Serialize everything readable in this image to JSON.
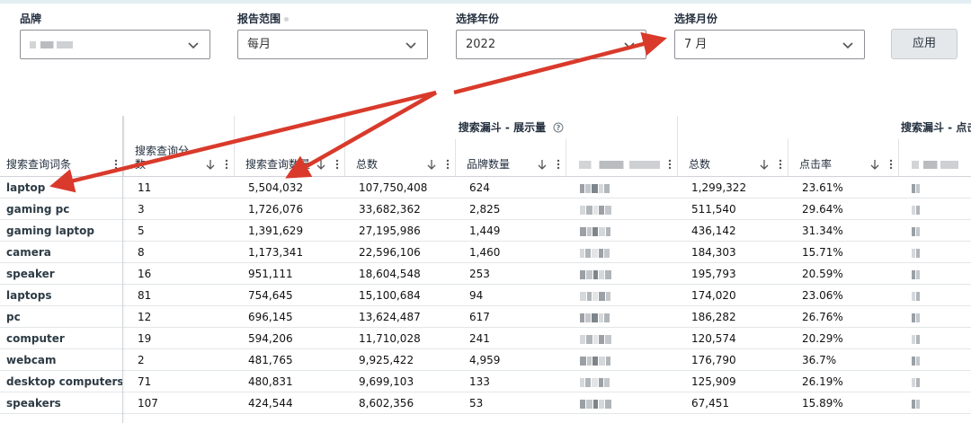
{
  "filters": {
    "brand": {
      "label": "品牌",
      "value": ""
    },
    "report_range": {
      "label": "报告范围",
      "value": "每月"
    },
    "year": {
      "label": "选择年份",
      "value": "2022"
    },
    "month": {
      "label": "选择月份",
      "value": "7 月"
    },
    "apply_label": "应用"
  },
  "table": {
    "groups": {
      "impressions": "搜索漏斗 - 展示量",
      "clicks": "搜索漏斗 - 点击"
    },
    "headers": {
      "keyword": "搜索查询词条",
      "score": "搜索查询分数",
      "volume": "搜索查询数量",
      "imp_total": "总数",
      "brand_count": "品牌数量",
      "click_total": "总数",
      "ctr": "点击率"
    },
    "rows": [
      {
        "keyword": "laptop",
        "score": "11",
        "volume": "5,504,032",
        "imp_total": "107,750,408",
        "brand_count": "624",
        "click_total": "1,299,322",
        "ctr": "23.61%"
      },
      {
        "keyword": "gaming pc",
        "score": "3",
        "volume": "1,726,076",
        "imp_total": "33,682,362",
        "brand_count": "2,825",
        "click_total": "511,540",
        "ctr": "29.64%"
      },
      {
        "keyword": "gaming laptop",
        "score": "5",
        "volume": "1,391,629",
        "imp_total": "27,195,986",
        "brand_count": "1,449",
        "click_total": "436,142",
        "ctr": "31.34%"
      },
      {
        "keyword": "camera",
        "score": "8",
        "volume": "1,173,341",
        "imp_total": "22,596,106",
        "brand_count": "1,460",
        "click_total": "184,303",
        "ctr": "15.71%"
      },
      {
        "keyword": "speaker",
        "score": "16",
        "volume": "951,111",
        "imp_total": "18,604,548",
        "brand_count": "253",
        "click_total": "195,793",
        "ctr": "20.59%"
      },
      {
        "keyword": "laptops",
        "score": "81",
        "volume": "754,645",
        "imp_total": "15,100,684",
        "brand_count": "94",
        "click_total": "174,020",
        "ctr": "23.06%"
      },
      {
        "keyword": "pc",
        "score": "12",
        "volume": "696,145",
        "imp_total": "13,624,487",
        "brand_count": "617",
        "click_total": "186,282",
        "ctr": "26.76%"
      },
      {
        "keyword": "computer",
        "score": "19",
        "volume": "594,206",
        "imp_total": "11,710,028",
        "brand_count": "241",
        "click_total": "120,574",
        "ctr": "20.29%"
      },
      {
        "keyword": "webcam",
        "score": "2",
        "volume": "481,765",
        "imp_total": "9,925,422",
        "brand_count": "4,959",
        "click_total": "176,790",
        "ctr": "36.7%"
      },
      {
        "keyword": "desktop computers",
        "score": "71",
        "volume": "480,831",
        "imp_total": "9,699,103",
        "brand_count": "133",
        "click_total": "125,909",
        "ctr": "26.19%"
      },
      {
        "keyword": "speakers",
        "score": "107",
        "volume": "424,544",
        "imp_total": "8,602,356",
        "brand_count": "53",
        "click_total": "67,451",
        "ctr": "15.89%"
      }
    ]
  },
  "colors": {
    "annotation_arrow": "#d93a2b"
  },
  "icons": {
    "dropdown": "chevron-down-icon",
    "sort": "arrow-down-icon",
    "column_menu": "kebab-icon",
    "info": "info-icon"
  }
}
